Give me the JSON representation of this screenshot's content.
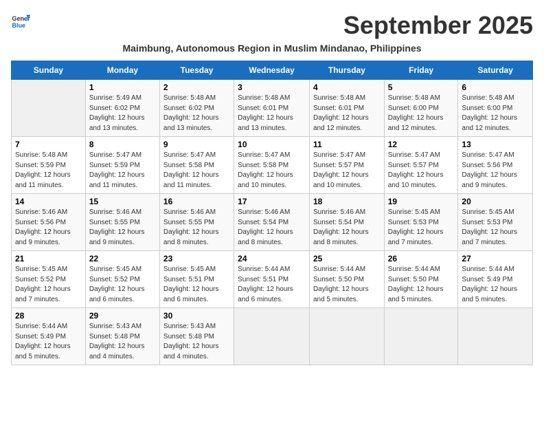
{
  "header": {
    "logo_line1": "General",
    "logo_line2": "Blue",
    "month_title": "September 2025",
    "subtitle": "Maimbung, Autonomous Region in Muslim Mindanao, Philippines"
  },
  "days_of_week": [
    "Sunday",
    "Monday",
    "Tuesday",
    "Wednesday",
    "Thursday",
    "Friday",
    "Saturday"
  ],
  "weeks": [
    [
      {
        "num": "",
        "info": ""
      },
      {
        "num": "1",
        "info": "Sunrise: 5:49 AM\nSunset: 6:02 PM\nDaylight: 12 hours\nand 13 minutes."
      },
      {
        "num": "2",
        "info": "Sunrise: 5:48 AM\nSunset: 6:02 PM\nDaylight: 12 hours\nand 13 minutes."
      },
      {
        "num": "3",
        "info": "Sunrise: 5:48 AM\nSunset: 6:01 PM\nDaylight: 12 hours\nand 13 minutes."
      },
      {
        "num": "4",
        "info": "Sunrise: 5:48 AM\nSunset: 6:01 PM\nDaylight: 12 hours\nand 12 minutes."
      },
      {
        "num": "5",
        "info": "Sunrise: 5:48 AM\nSunset: 6:00 PM\nDaylight: 12 hours\nand 12 minutes."
      },
      {
        "num": "6",
        "info": "Sunrise: 5:48 AM\nSunset: 6:00 PM\nDaylight: 12 hours\nand 12 minutes."
      }
    ],
    [
      {
        "num": "7",
        "info": "Sunrise: 5:48 AM\nSunset: 5:59 PM\nDaylight: 12 hours\nand 11 minutes."
      },
      {
        "num": "8",
        "info": "Sunrise: 5:47 AM\nSunset: 5:59 PM\nDaylight: 12 hours\nand 11 minutes."
      },
      {
        "num": "9",
        "info": "Sunrise: 5:47 AM\nSunset: 5:58 PM\nDaylight: 12 hours\nand 11 minutes."
      },
      {
        "num": "10",
        "info": "Sunrise: 5:47 AM\nSunset: 5:58 PM\nDaylight: 12 hours\nand 10 minutes."
      },
      {
        "num": "11",
        "info": "Sunrise: 5:47 AM\nSunset: 5:57 PM\nDaylight: 12 hours\nand 10 minutes."
      },
      {
        "num": "12",
        "info": "Sunrise: 5:47 AM\nSunset: 5:57 PM\nDaylight: 12 hours\nand 10 minutes."
      },
      {
        "num": "13",
        "info": "Sunrise: 5:47 AM\nSunset: 5:56 PM\nDaylight: 12 hours\nand 9 minutes."
      }
    ],
    [
      {
        "num": "14",
        "info": "Sunrise: 5:46 AM\nSunset: 5:56 PM\nDaylight: 12 hours\nand 9 minutes."
      },
      {
        "num": "15",
        "info": "Sunrise: 5:46 AM\nSunset: 5:55 PM\nDaylight: 12 hours\nand 9 minutes."
      },
      {
        "num": "16",
        "info": "Sunrise: 5:46 AM\nSunset: 5:55 PM\nDaylight: 12 hours\nand 8 minutes."
      },
      {
        "num": "17",
        "info": "Sunrise: 5:46 AM\nSunset: 5:54 PM\nDaylight: 12 hours\nand 8 minutes."
      },
      {
        "num": "18",
        "info": "Sunrise: 5:46 AM\nSunset: 5:54 PM\nDaylight: 12 hours\nand 8 minutes."
      },
      {
        "num": "19",
        "info": "Sunrise: 5:45 AM\nSunset: 5:53 PM\nDaylight: 12 hours\nand 7 minutes."
      },
      {
        "num": "20",
        "info": "Sunrise: 5:45 AM\nSunset: 5:53 PM\nDaylight: 12 hours\nand 7 minutes."
      }
    ],
    [
      {
        "num": "21",
        "info": "Sunrise: 5:45 AM\nSunset: 5:52 PM\nDaylight: 12 hours\nand 7 minutes."
      },
      {
        "num": "22",
        "info": "Sunrise: 5:45 AM\nSunset: 5:52 PM\nDaylight: 12 hours\nand 6 minutes."
      },
      {
        "num": "23",
        "info": "Sunrise: 5:45 AM\nSunset: 5:51 PM\nDaylight: 12 hours\nand 6 minutes."
      },
      {
        "num": "24",
        "info": "Sunrise: 5:44 AM\nSunset: 5:51 PM\nDaylight: 12 hours\nand 6 minutes."
      },
      {
        "num": "25",
        "info": "Sunrise: 5:44 AM\nSunset: 5:50 PM\nDaylight: 12 hours\nand 5 minutes."
      },
      {
        "num": "26",
        "info": "Sunrise: 5:44 AM\nSunset: 5:50 PM\nDaylight: 12 hours\nand 5 minutes."
      },
      {
        "num": "27",
        "info": "Sunrise: 5:44 AM\nSunset: 5:49 PM\nDaylight: 12 hours\nand 5 minutes."
      }
    ],
    [
      {
        "num": "28",
        "info": "Sunrise: 5:44 AM\nSunset: 5:49 PM\nDaylight: 12 hours\nand 5 minutes."
      },
      {
        "num": "29",
        "info": "Sunrise: 5:43 AM\nSunset: 5:48 PM\nDaylight: 12 hours\nand 4 minutes."
      },
      {
        "num": "30",
        "info": "Sunrise: 5:43 AM\nSunset: 5:48 PM\nDaylight: 12 hours\nand 4 minutes."
      },
      {
        "num": "",
        "info": ""
      },
      {
        "num": "",
        "info": ""
      },
      {
        "num": "",
        "info": ""
      },
      {
        "num": "",
        "info": ""
      }
    ]
  ]
}
